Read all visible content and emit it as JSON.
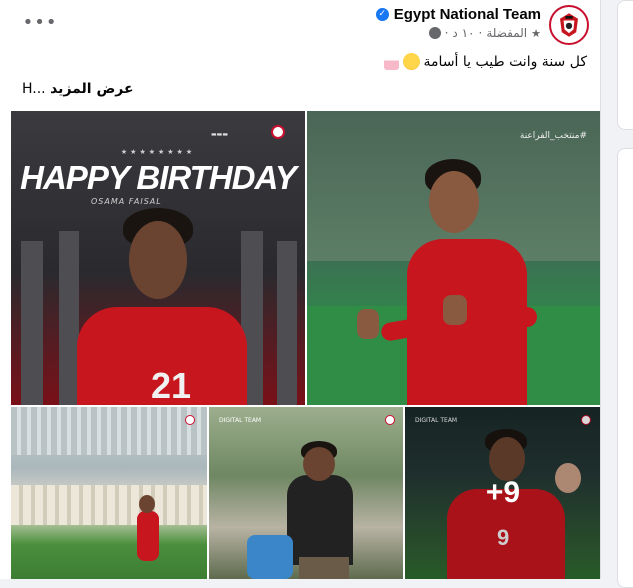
{
  "post": {
    "page_name": "Egypt National Team",
    "meta_time": "١٠ د",
    "meta_audience": "المفضلة",
    "text": "كل سنة وانت طيب يا أسامة",
    "see_more": "عرض المزيد",
    "see_more_prefix": "H...",
    "more_icon": "ellipsis-icon"
  },
  "photos": {
    "birthday": {
      "stars": "★★★★★★★★",
      "title": "HAPPY BIRTHDAY",
      "subtitle": "OSAMA FAISAL",
      "number": "21"
    },
    "training": {
      "hashtag": "#منتخب_الفراعنة"
    },
    "match_number": "9",
    "digital_label": "DIGITAL TEAM",
    "more_count": "+9"
  },
  "colors": {
    "brand_red": "#c8161f",
    "verified_blue": "#1877f2"
  }
}
